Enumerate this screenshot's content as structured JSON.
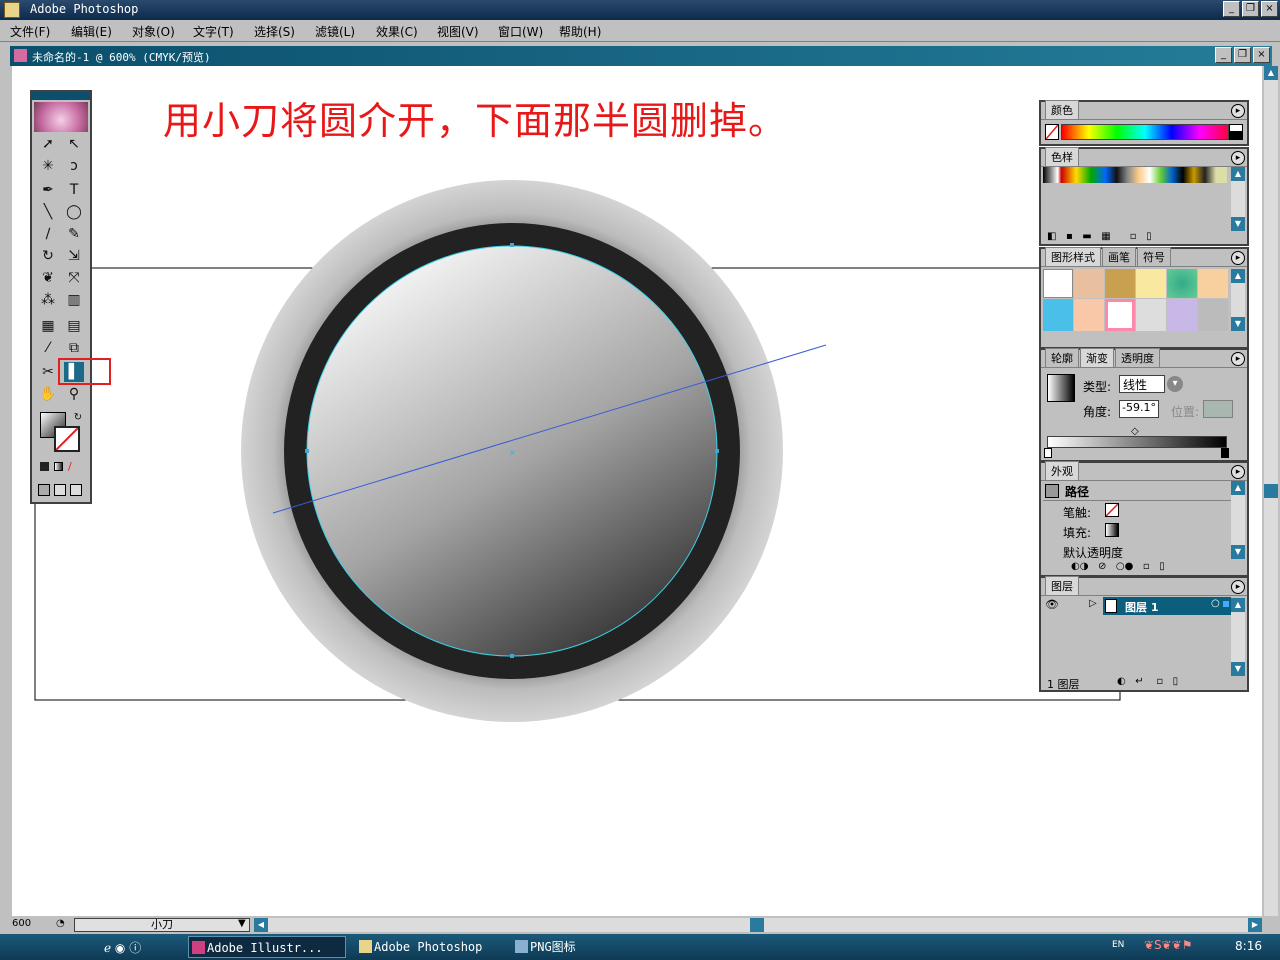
{
  "app": {
    "title": "Adobe Photoshop"
  },
  "menu": [
    "文件(F)",
    "编辑(E)",
    "对象(O)",
    "文字(T)",
    "选择(S)",
    "滤镜(L)",
    "效果(C)",
    "视图(V)",
    "窗口(W)",
    "帮助(H)"
  ],
  "document": {
    "title": "未命名的-1 @ 600% (CMYK/预览)"
  },
  "instruction": "用小刀将圆介开，下面那半圆删掉。",
  "panels": {
    "color": {
      "tab": "颜色"
    },
    "swatches": {
      "tab": "色样"
    },
    "styles": {
      "tabs": [
        "图形样式",
        "画笔",
        "符号"
      ]
    },
    "gradient": {
      "tabs": [
        "轮廓",
        "渐变",
        "透明度"
      ],
      "type_label": "类型:",
      "type_value": "线性",
      "angle_label": "角度:",
      "angle_value": "-59.1°",
      "location_label": "位置:"
    },
    "appearance": {
      "tab": "外观",
      "header": "路径",
      "stroke_label": "笔触:",
      "fill_label": "填充:",
      "opacity_label": "默认透明度"
    },
    "layers": {
      "tab": "图层",
      "layer_name": "图层 1",
      "count": "1 图层"
    }
  },
  "status": {
    "zoom": "600",
    "current_tool": "小刀"
  },
  "taskbar": {
    "tasks": [
      "Adobe Illustr...",
      "Adobe Photoshop",
      "PNG图标"
    ],
    "lang": "EN",
    "clock": "8:16"
  },
  "colors": {
    "accent": "#0b4f6c",
    "instruction": "#e81818",
    "path": "#3aa8d8"
  }
}
